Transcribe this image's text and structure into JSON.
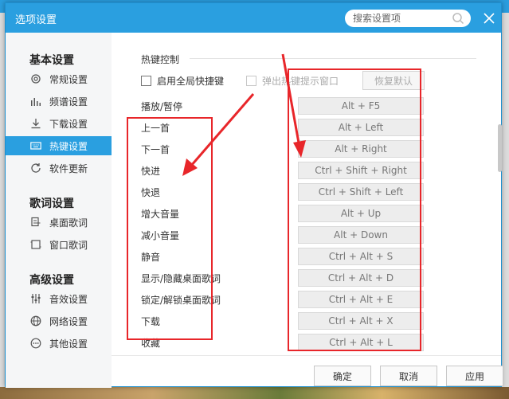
{
  "dialog": {
    "title": "选项设置",
    "close_icon": "close-icon"
  },
  "search": {
    "placeholder": "搜索设置项",
    "icon": "search-icon"
  },
  "sidebar": {
    "groups": [
      {
        "title": "基本设置",
        "items": [
          {
            "label": "常规设置",
            "icon": "gear-icon"
          },
          {
            "label": "频谱设置",
            "icon": "spectrum-bars-icon"
          },
          {
            "label": "下载设置",
            "icon": "download-icon"
          },
          {
            "label": "热键设置",
            "icon": "keyboard-icon",
            "active": true
          },
          {
            "label": "软件更新",
            "icon": "refresh-icon"
          }
        ]
      },
      {
        "title": "歌词设置",
        "items": [
          {
            "label": "桌面歌词",
            "icon": "desktop-lyrics-icon"
          },
          {
            "label": "窗口歌词",
            "icon": "window-lyrics-icon"
          }
        ]
      },
      {
        "title": "高级设置",
        "items": [
          {
            "label": "音效设置",
            "icon": "equalizer-icon"
          },
          {
            "label": "网络设置",
            "icon": "globe-icon"
          },
          {
            "label": "其他设置",
            "icon": "more-icon"
          }
        ]
      }
    ]
  },
  "hotkeys": {
    "section_title": "热键控制",
    "enable_global_label": "启用全局快捷键",
    "enable_global_checked": false,
    "popup_conflict_label": "弹出热键提示窗口",
    "popup_conflict_checked": false,
    "restore_default_label": "恢复默认",
    "rows": [
      {
        "action": "播放/暂停",
        "keys": "Alt + F5"
      },
      {
        "action": "上一首",
        "keys": "Alt + Left"
      },
      {
        "action": "下一首",
        "keys": "Alt + Right"
      },
      {
        "action": "快进",
        "keys": "Ctrl + Shift + Right"
      },
      {
        "action": "快退",
        "keys": "Ctrl + Shift + Left"
      },
      {
        "action": "增大音量",
        "keys": "Alt + Up"
      },
      {
        "action": "减小音量",
        "keys": "Alt + Down"
      },
      {
        "action": "静音",
        "keys": "Ctrl + Alt + S"
      },
      {
        "action": "显示/隐藏桌面歌词",
        "keys": "Ctrl + Alt + D"
      },
      {
        "action": "锁定/解锁桌面歌词",
        "keys": "Ctrl + Alt + E"
      },
      {
        "action": "下载",
        "keys": "Ctrl + Alt + X"
      },
      {
        "action": "收藏",
        "keys": "Ctrl + Alt + L"
      }
    ]
  },
  "footer": {
    "ok_label": "确定",
    "cancel_label": "取消",
    "apply_label": "应用"
  },
  "colors": {
    "accent": "#2a9fe0",
    "annotation": "#e8262a"
  }
}
